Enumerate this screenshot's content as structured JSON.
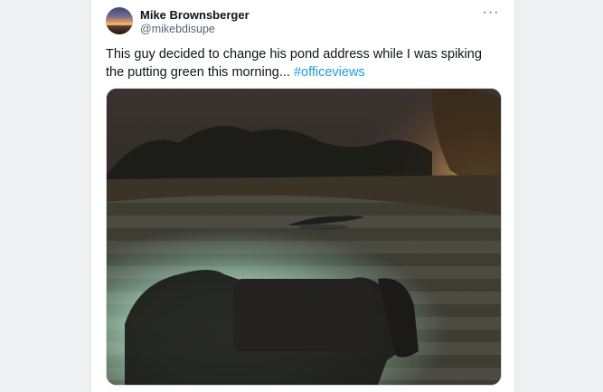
{
  "tweet": {
    "author_name": "Mike Brownsberger",
    "author_handle": "@mikebdisupe",
    "more_icon": "more-horizontal-icon",
    "text": "This guy decided to change his pond address while I was spiking the putting green this morning...",
    "hashtag": "#officeviews"
  },
  "colors": {
    "link": "#1d9bf0",
    "text": "#0f1419",
    "secondary": "#536471"
  }
}
